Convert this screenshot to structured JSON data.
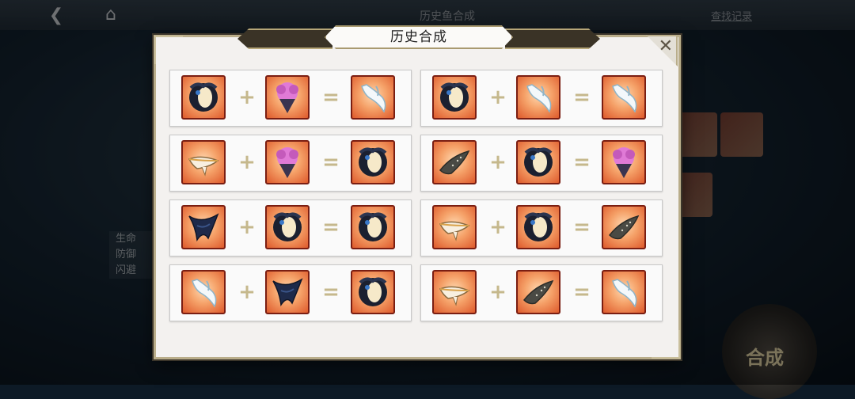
{
  "background": {
    "title": "历史鱼合成",
    "record_link": "查找记录",
    "stats": [
      "生命",
      "防御",
      "闪避"
    ],
    "synth_button": "合成"
  },
  "dialog": {
    "title": "历史合成",
    "close_icon": "close-icon",
    "plus_symbol": "+",
    "equals_symbol": "=",
    "recipes": [
      {
        "a": "black-fish",
        "b": "pink-fish",
        "result": "white-fish"
      },
      {
        "a": "black-fish",
        "b": "white-fish",
        "result": "white-fish"
      },
      {
        "a": "shark",
        "b": "pink-fish",
        "result": "black-fish"
      },
      {
        "a": "whale-shark",
        "b": "black-fish",
        "result": "pink-fish"
      },
      {
        "a": "dark-ray",
        "b": "black-fish",
        "result": "black-fish"
      },
      {
        "a": "shark",
        "b": "black-fish",
        "result": "whale-shark"
      },
      {
        "a": "white-fish",
        "b": "dark-ray",
        "result": "black-fish"
      },
      {
        "a": "shark",
        "b": "whale-shark",
        "result": "white-fish"
      }
    ]
  },
  "colors": {
    "accent": "#c5b88c",
    "card_border": "#7a1e12",
    "card_fill": "#f5a168"
  }
}
